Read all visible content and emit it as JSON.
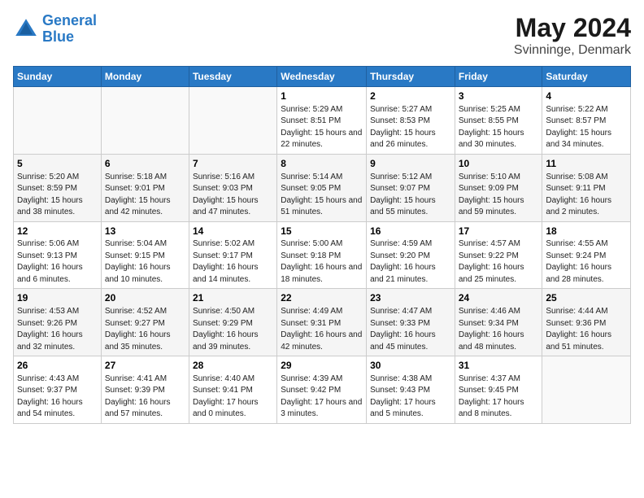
{
  "header": {
    "logo_line1": "General",
    "logo_line2": "Blue",
    "main_title": "May 2024",
    "subtitle": "Svinninge, Denmark"
  },
  "days_of_week": [
    "Sunday",
    "Monday",
    "Tuesday",
    "Wednesday",
    "Thursday",
    "Friday",
    "Saturday"
  ],
  "weeks": [
    [
      {
        "num": "",
        "info": ""
      },
      {
        "num": "",
        "info": ""
      },
      {
        "num": "",
        "info": ""
      },
      {
        "num": "1",
        "info": "Sunrise: 5:29 AM\nSunset: 8:51 PM\nDaylight: 15 hours\nand 22 minutes."
      },
      {
        "num": "2",
        "info": "Sunrise: 5:27 AM\nSunset: 8:53 PM\nDaylight: 15 hours\nand 26 minutes."
      },
      {
        "num": "3",
        "info": "Sunrise: 5:25 AM\nSunset: 8:55 PM\nDaylight: 15 hours\nand 30 minutes."
      },
      {
        "num": "4",
        "info": "Sunrise: 5:22 AM\nSunset: 8:57 PM\nDaylight: 15 hours\nand 34 minutes."
      }
    ],
    [
      {
        "num": "5",
        "info": "Sunrise: 5:20 AM\nSunset: 8:59 PM\nDaylight: 15 hours\nand 38 minutes."
      },
      {
        "num": "6",
        "info": "Sunrise: 5:18 AM\nSunset: 9:01 PM\nDaylight: 15 hours\nand 42 minutes."
      },
      {
        "num": "7",
        "info": "Sunrise: 5:16 AM\nSunset: 9:03 PM\nDaylight: 15 hours\nand 47 minutes."
      },
      {
        "num": "8",
        "info": "Sunrise: 5:14 AM\nSunset: 9:05 PM\nDaylight: 15 hours\nand 51 minutes."
      },
      {
        "num": "9",
        "info": "Sunrise: 5:12 AM\nSunset: 9:07 PM\nDaylight: 15 hours\nand 55 minutes."
      },
      {
        "num": "10",
        "info": "Sunrise: 5:10 AM\nSunset: 9:09 PM\nDaylight: 15 hours\nand 59 minutes."
      },
      {
        "num": "11",
        "info": "Sunrise: 5:08 AM\nSunset: 9:11 PM\nDaylight: 16 hours\nand 2 minutes."
      }
    ],
    [
      {
        "num": "12",
        "info": "Sunrise: 5:06 AM\nSunset: 9:13 PM\nDaylight: 16 hours\nand 6 minutes."
      },
      {
        "num": "13",
        "info": "Sunrise: 5:04 AM\nSunset: 9:15 PM\nDaylight: 16 hours\nand 10 minutes."
      },
      {
        "num": "14",
        "info": "Sunrise: 5:02 AM\nSunset: 9:17 PM\nDaylight: 16 hours\nand 14 minutes."
      },
      {
        "num": "15",
        "info": "Sunrise: 5:00 AM\nSunset: 9:18 PM\nDaylight: 16 hours\nand 18 minutes."
      },
      {
        "num": "16",
        "info": "Sunrise: 4:59 AM\nSunset: 9:20 PM\nDaylight: 16 hours\nand 21 minutes."
      },
      {
        "num": "17",
        "info": "Sunrise: 4:57 AM\nSunset: 9:22 PM\nDaylight: 16 hours\nand 25 minutes."
      },
      {
        "num": "18",
        "info": "Sunrise: 4:55 AM\nSunset: 9:24 PM\nDaylight: 16 hours\nand 28 minutes."
      }
    ],
    [
      {
        "num": "19",
        "info": "Sunrise: 4:53 AM\nSunset: 9:26 PM\nDaylight: 16 hours\nand 32 minutes."
      },
      {
        "num": "20",
        "info": "Sunrise: 4:52 AM\nSunset: 9:27 PM\nDaylight: 16 hours\nand 35 minutes."
      },
      {
        "num": "21",
        "info": "Sunrise: 4:50 AM\nSunset: 9:29 PM\nDaylight: 16 hours\nand 39 minutes."
      },
      {
        "num": "22",
        "info": "Sunrise: 4:49 AM\nSunset: 9:31 PM\nDaylight: 16 hours\nand 42 minutes."
      },
      {
        "num": "23",
        "info": "Sunrise: 4:47 AM\nSunset: 9:33 PM\nDaylight: 16 hours\nand 45 minutes."
      },
      {
        "num": "24",
        "info": "Sunrise: 4:46 AM\nSunset: 9:34 PM\nDaylight: 16 hours\nand 48 minutes."
      },
      {
        "num": "25",
        "info": "Sunrise: 4:44 AM\nSunset: 9:36 PM\nDaylight: 16 hours\nand 51 minutes."
      }
    ],
    [
      {
        "num": "26",
        "info": "Sunrise: 4:43 AM\nSunset: 9:37 PM\nDaylight: 16 hours\nand 54 minutes."
      },
      {
        "num": "27",
        "info": "Sunrise: 4:41 AM\nSunset: 9:39 PM\nDaylight: 16 hours\nand 57 minutes."
      },
      {
        "num": "28",
        "info": "Sunrise: 4:40 AM\nSunset: 9:41 PM\nDaylight: 17 hours\nand 0 minutes."
      },
      {
        "num": "29",
        "info": "Sunrise: 4:39 AM\nSunset: 9:42 PM\nDaylight: 17 hours\nand 3 minutes."
      },
      {
        "num": "30",
        "info": "Sunrise: 4:38 AM\nSunset: 9:43 PM\nDaylight: 17 hours\nand 5 minutes."
      },
      {
        "num": "31",
        "info": "Sunrise: 4:37 AM\nSunset: 9:45 PM\nDaylight: 17 hours\nand 8 minutes."
      },
      {
        "num": "",
        "info": ""
      }
    ]
  ]
}
